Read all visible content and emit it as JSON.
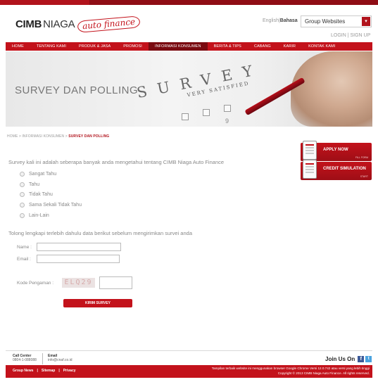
{
  "header": {
    "logo": {
      "cimb": "CIMB",
      "niaga": "NIAGA",
      "sub": "auto finance"
    },
    "lang": {
      "english": "English",
      "bahasa": "Bahasa"
    },
    "group_select": {
      "value": "Group Websites"
    },
    "login": "LOGIN | SIGN UP"
  },
  "nav": [
    "HOME",
    "TENTANG KAMI",
    "PRODUK & JASA",
    "PROMOSI",
    "INFORMASI KONSUMEN",
    "BERITA & TIPS",
    "CABANG",
    "KARIR",
    "KONTAK KAMI"
  ],
  "nav_active_index": 4,
  "banner": {
    "title": "SURVEY DAN POLLING",
    "word": "SURVEY",
    "caption": "VERY SATISFIED",
    "digit": "9"
  },
  "breadcrumb": {
    "path": "HOME > INFORMASI KONSUMEN > ",
    "current": "SURVEY DAN POLLING"
  },
  "survey": {
    "question": "Survey kali ini adalah seberapa banyak anda mengetahui tentang CIMB Niaga Auto Finance",
    "options": [
      "Sangat Tahu",
      "Tahu",
      "Tidak Tahu",
      "Sama Sekali Tidak Tahu",
      "Lain-Lain"
    ]
  },
  "form": {
    "instruction": "Tolong lengkapi terlebih dahulu data berikut sebelum mengirimkan survei anda",
    "name_label": "Name :",
    "email_label": "Email :",
    "security_label": "Kode Pengaman :",
    "captcha": "ELQ29",
    "submit": "KIRIM SURVEY"
  },
  "side": {
    "apply": {
      "label": "APPLY NOW",
      "sub": "FILL FORM"
    },
    "credit": {
      "label": "CREDIT SIMULATION",
      "sub": "START"
    }
  },
  "footer_contact": {
    "call_label": "Call Center",
    "call_value": "0804-1-088088",
    "email_label": "Email",
    "email_value": "info@cnaf.co.id",
    "join": "Join Us On"
  },
  "footer": {
    "links": [
      "Group News",
      "Sitemap",
      "Privacy"
    ],
    "separator": "|",
    "note": "Tampilan terbaik website ini menggunakan browser Google Chrome Versi 12.0.742 atau versi yang lebih tinggi",
    "copyright": "Copyright © 2013 CIMB Niaga Auto Finance. All rights reserved."
  },
  "colors": {
    "brand_red": "#c3121b",
    "dark_red": "#7a0a10"
  },
  "icons": [
    "chevron-down-icon",
    "document-icon",
    "calculator-icon",
    "facebook-icon",
    "twitter-icon"
  ]
}
